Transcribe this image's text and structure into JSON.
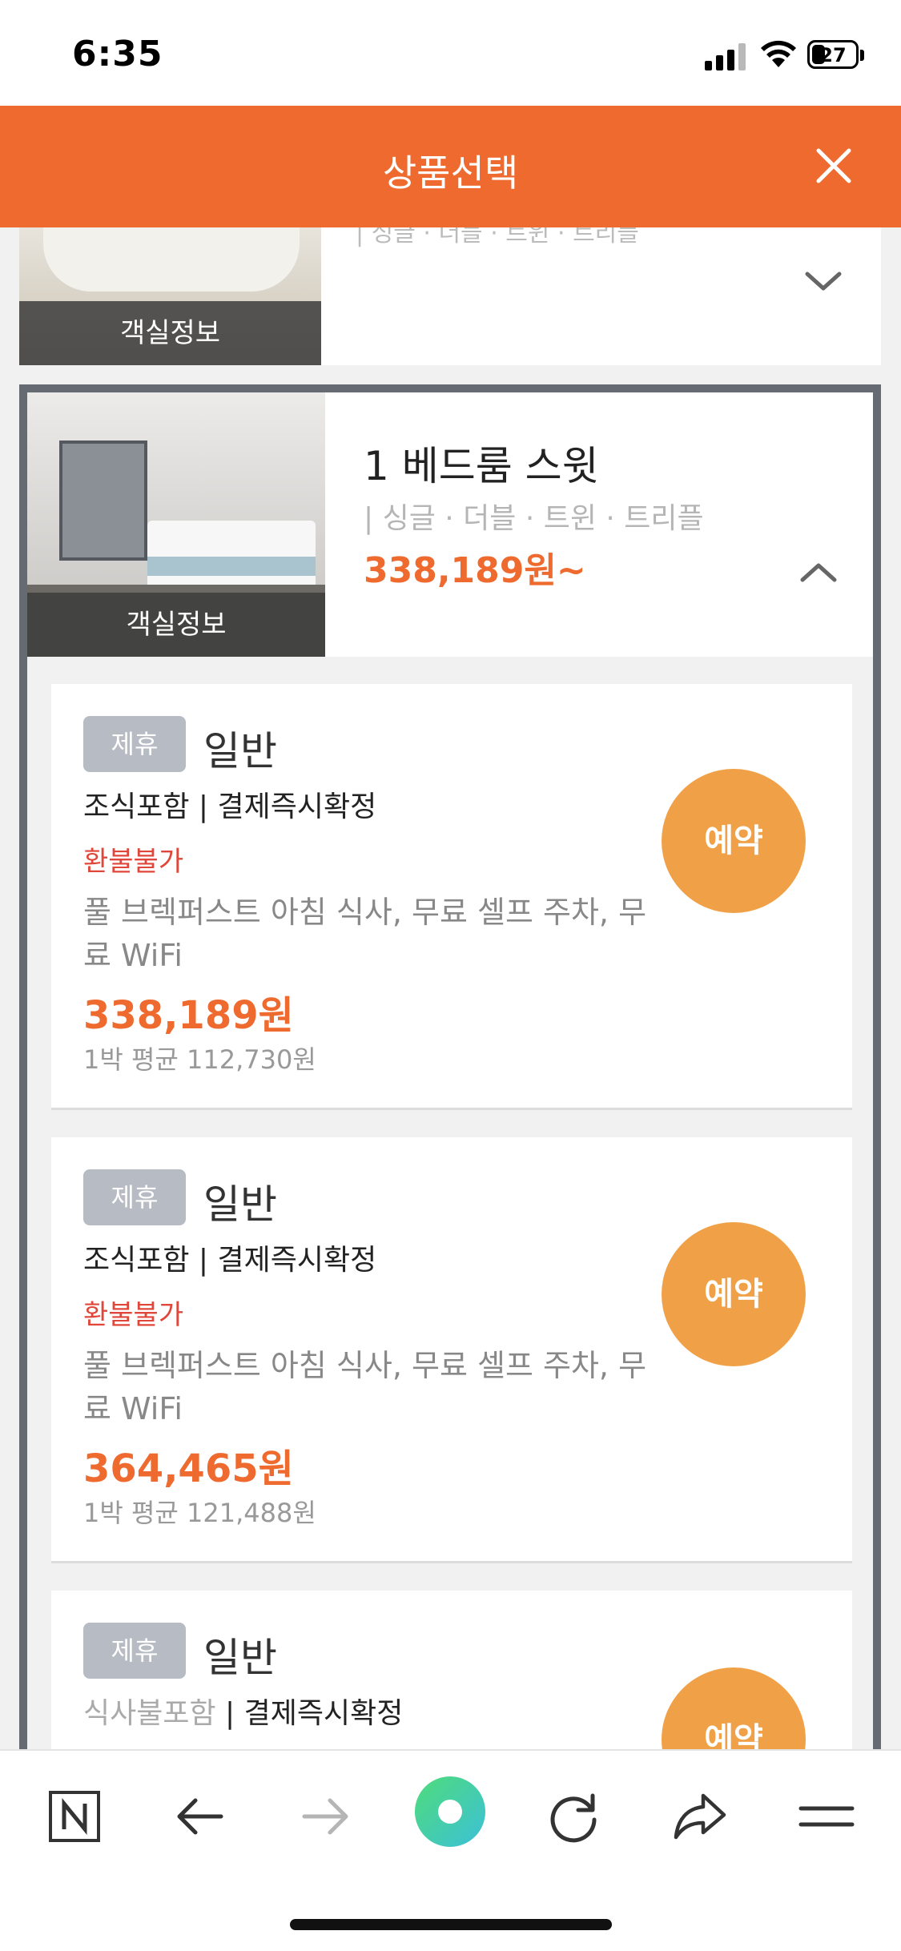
{
  "status_bar": {
    "time": "6:35",
    "battery": "27"
  },
  "header": {
    "title": "상품선택"
  },
  "previous_room": {
    "info_label": "객실정보",
    "cutoff_text": "| 싱글 · 더블 · 트윈 · 트리플"
  },
  "room": {
    "info_label": "객실정보",
    "name": "1 베드룸 스윗",
    "bed_types": "| 싱글 · 더블 · 트윈 · 트리플",
    "price_from": "338,189원~"
  },
  "offers": [
    {
      "badge": "제휴",
      "type": "일반",
      "meal": "조식포함",
      "payment": "결제즉시확정",
      "refund": "환불불가",
      "description": "풀 브렉퍼스트 아침 식사, 무료 셀프 주차, 무료 WiFi",
      "price": "338,189원",
      "nightly_avg": "1박 평균 112,730원",
      "button": "예약"
    },
    {
      "badge": "제휴",
      "type": "일반",
      "meal": "조식포함",
      "payment": "결제즉시확정",
      "refund": "환불불가",
      "description": "풀 브렉퍼스트 아침 식사, 무료 셀프 주차, 무료 WiFi",
      "price": "364,465원",
      "nightly_avg": "1박 평균 121,488원",
      "button": "예약"
    },
    {
      "badge": "제휴",
      "type": "일반",
      "meal": "식사불포함",
      "payment": "결제즉시확정",
      "button": "예약"
    }
  ],
  "toolbar": {
    "items": [
      "naver-home-icon",
      "back-arrow-icon",
      "forward-arrow-icon",
      "green-dot-icon",
      "refresh-icon",
      "share-icon",
      "menu-icon"
    ]
  },
  "colors": {
    "accent": "#ee6a2f",
    "button": "#f0a148",
    "refund": "#e0473a",
    "badge": "#b7bbc3"
  }
}
